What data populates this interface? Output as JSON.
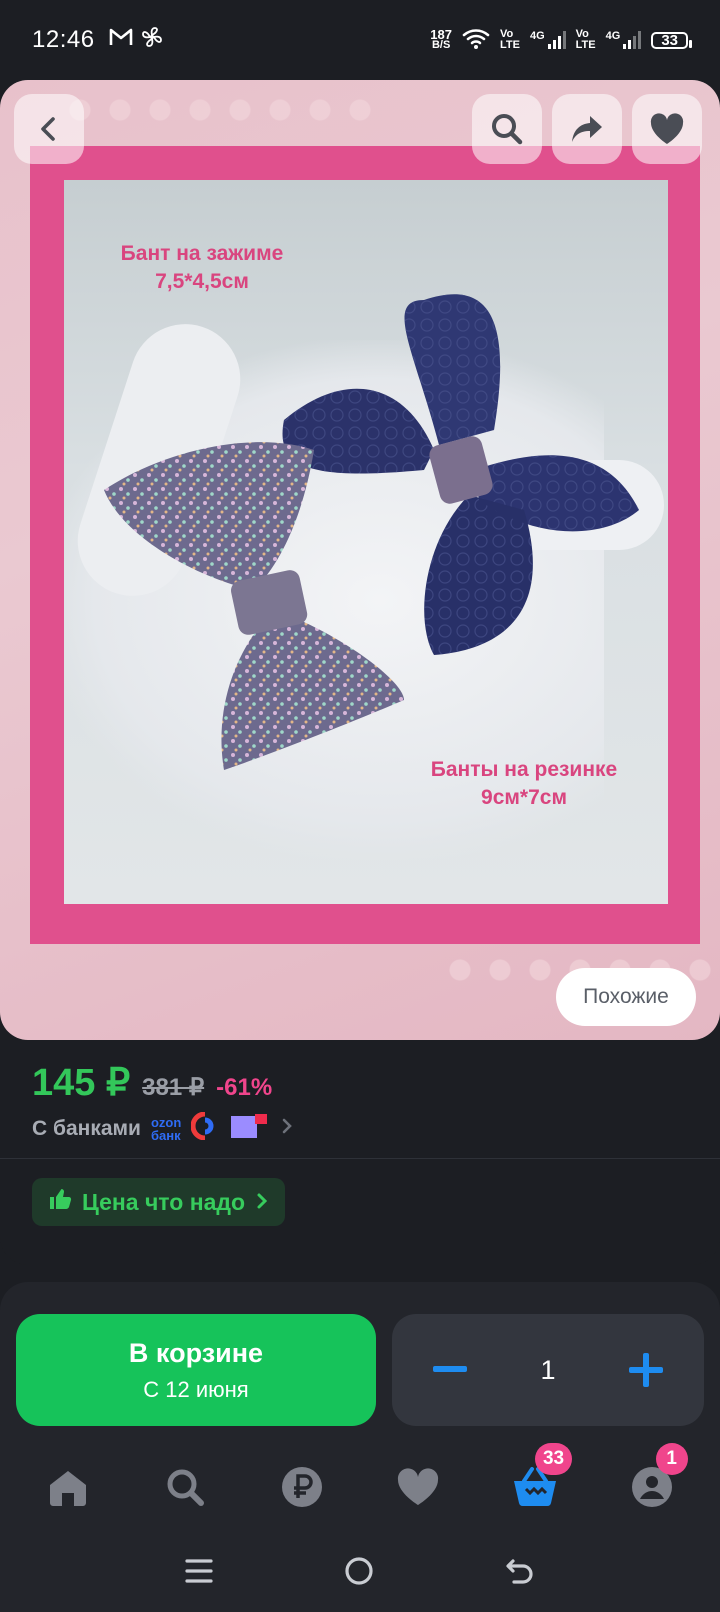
{
  "status_bar": {
    "time": "12:46",
    "net_speed_value": "187",
    "net_speed_unit": "B/S",
    "sim1_tech": "Vo\nLTE",
    "sim1_gen": "4G",
    "sim2_tech": "Vo\nLTE",
    "sim2_gen": "4G",
    "battery": "33"
  },
  "product_image": {
    "caption_clip": "Бант на зажиме\n7,5*4,5см",
    "caption_elastic": "Банты на резинке\n9см*7см",
    "similar_label": "Похожие"
  },
  "pricing": {
    "price": "145 ₽",
    "old_price": "381 ₽",
    "discount": "-61%",
    "banks_label": "С банками",
    "ozon_bank_line1": "ozon",
    "ozon_bank_line2": "банк",
    "good_price_label": "Цена что надо"
  },
  "cart": {
    "button_title": "В корзине",
    "button_subtitle": "С 12 июня",
    "quantity": "1"
  },
  "bottom_nav": {
    "cart_badge": "33",
    "profile_badge": "1"
  },
  "colors": {
    "accent_green": "#16c35a",
    "price_green": "#33c75a",
    "discount_pink": "#f0458c",
    "stepper_blue": "#1e8cf0",
    "active_tab_blue": "#1e8cf0"
  }
}
